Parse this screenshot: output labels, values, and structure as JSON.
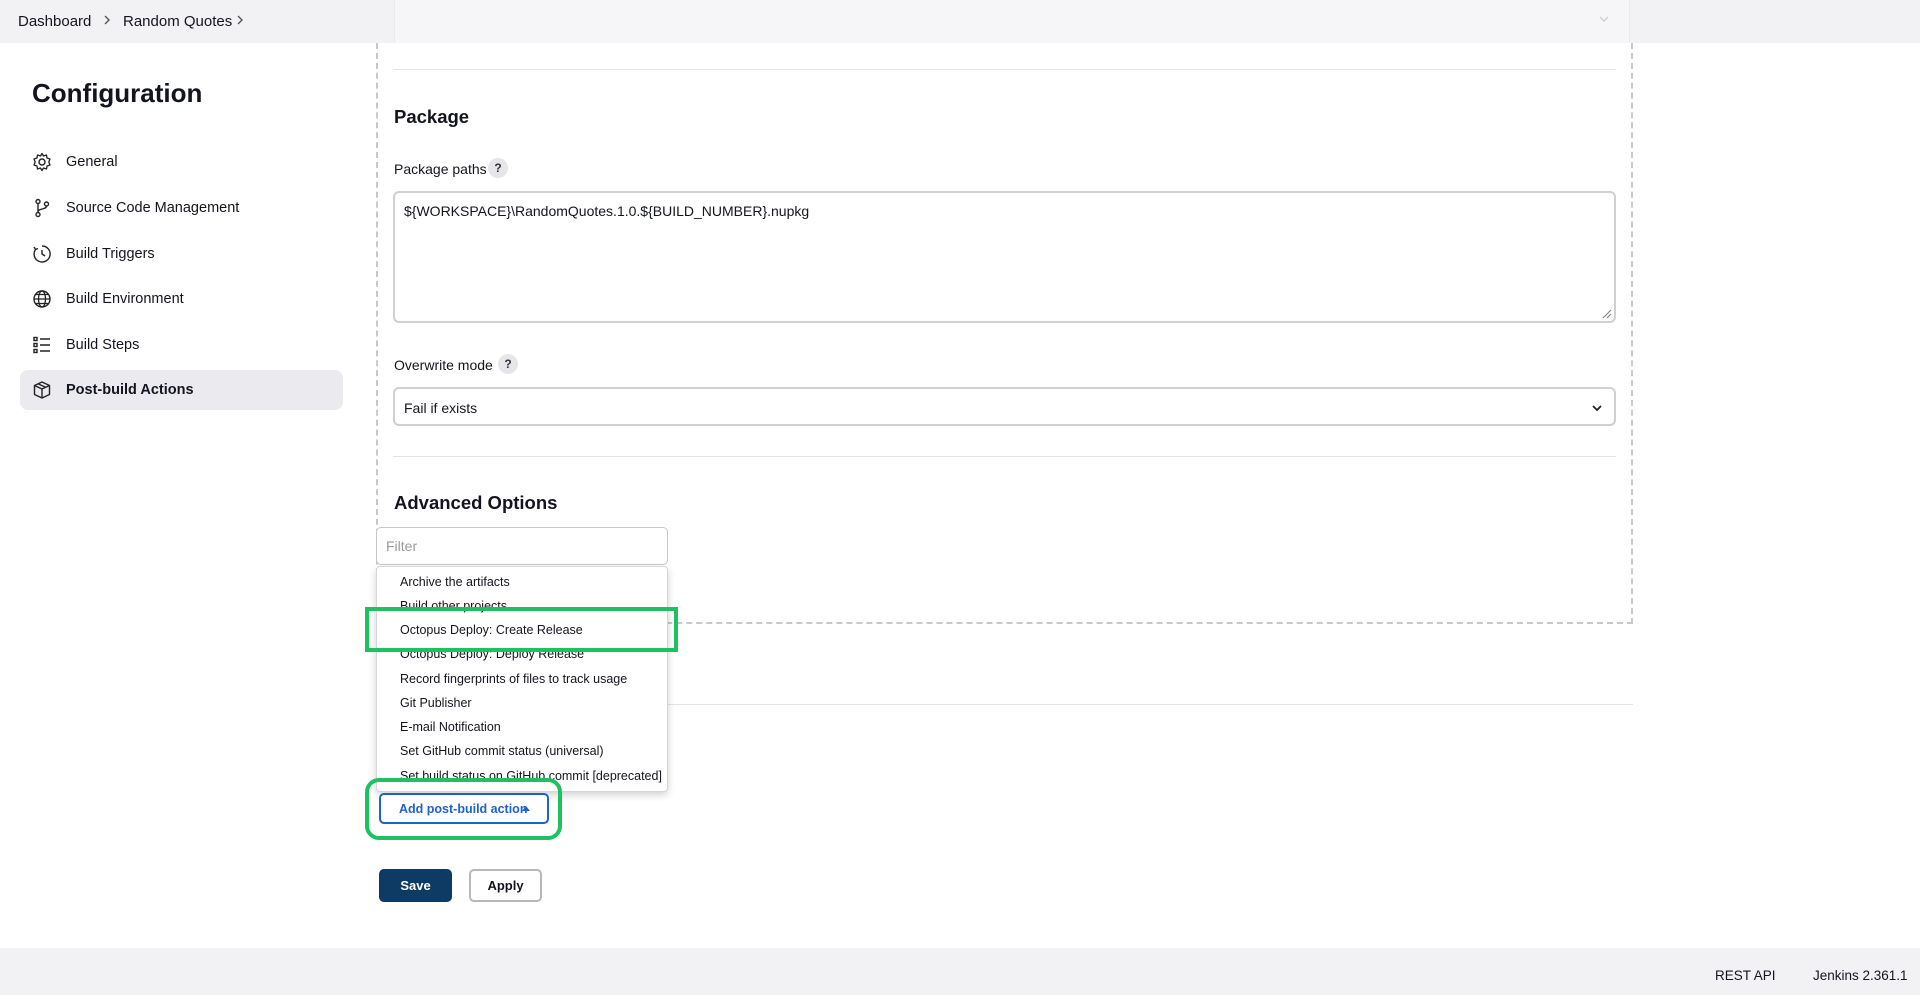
{
  "breadcrumb": {
    "items": [
      "Dashboard",
      "Random Quotes"
    ]
  },
  "page_title": "Configuration",
  "sidebar": {
    "items": [
      {
        "label": "General",
        "icon": "gear-icon",
        "active": false
      },
      {
        "label": "Source Code Management",
        "icon": "branch-icon",
        "active": false
      },
      {
        "label": "Build Triggers",
        "icon": "clock-icon",
        "active": false
      },
      {
        "label": "Build Environment",
        "icon": "globe-icon",
        "active": false
      },
      {
        "label": "Build Steps",
        "icon": "list-icon",
        "active": false
      },
      {
        "label": "Post-build Actions",
        "icon": "package-icon",
        "active": true
      }
    ]
  },
  "package": {
    "heading": "Package",
    "paths_label": "Package paths",
    "paths_value": "${WORKSPACE}\\RandomQuotes.1.0.${BUILD_NUMBER}.nupkg",
    "overwrite_label": "Overwrite mode",
    "overwrite_value": "Fail if exists",
    "help_symbol": "?"
  },
  "advanced": {
    "heading": "Advanced Options"
  },
  "filter": {
    "placeholder": "Filter"
  },
  "dropdown": {
    "items": [
      "Archive the artifacts",
      "Build other projects",
      "Octopus Deploy: Create Release",
      "Octopus Deploy: Deploy Release",
      "Record fingerprints of files to track usage",
      "Git Publisher",
      "E-mail Notification",
      "Set GitHub commit status (universal)",
      "Set build status on GitHub commit [deprecated]"
    ],
    "highlighted_index": 2
  },
  "actions": {
    "add_label": "Add post-build action",
    "save_label": "Save",
    "apply_label": "Apply"
  },
  "footer": {
    "rest_api": "REST API",
    "version": "Jenkins 2.361.1"
  },
  "colors": {
    "highlight": "#1ec15f",
    "primary": "#0d3b63",
    "link": "#1b63c7"
  }
}
